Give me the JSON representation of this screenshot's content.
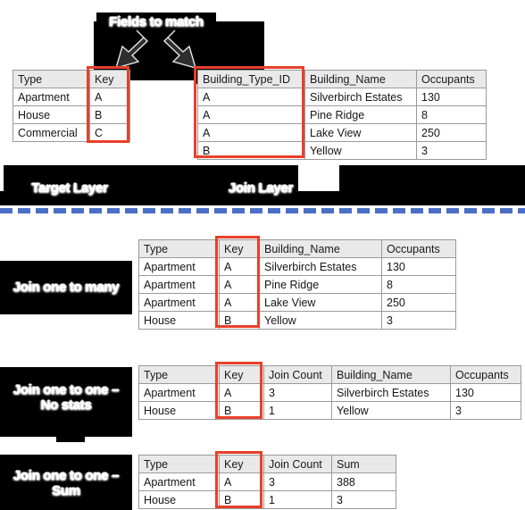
{
  "diagram": {
    "title_callout": "Fields to match",
    "layer_labels": {
      "target": "Target Layer",
      "join": "Join Layer"
    },
    "section_labels": {
      "one_to_many": "Join one to many",
      "one_to_one_no_stats": "Join one to one –\nNo stats",
      "one_to_one_sum": "Join one to one –\nSum"
    },
    "colors": {
      "highlight": "#e8402a",
      "divider": "#4a6fc4",
      "callout_bg": "#000000",
      "table_header_bg": "#e9e9e9"
    },
    "icons": {
      "arrow_left": "arrow-down-left-icon",
      "arrow_right": "arrow-down-right-icon"
    }
  },
  "tables": {
    "target_layer": {
      "name": "Target Layer Table",
      "headers": [
        "Type",
        "Key"
      ],
      "rows": [
        [
          "Apartment",
          "A"
        ],
        [
          "House",
          "B"
        ],
        [
          "Commercial",
          "C"
        ]
      ]
    },
    "join_layer": {
      "name": "Join Layer Table",
      "headers": [
        "Building_Type_ID",
        "Building_Name",
        "Occupants"
      ],
      "rows": [
        [
          "A",
          "Silverbirch Estates",
          "130"
        ],
        [
          "A",
          "Pine Ridge",
          "8"
        ],
        [
          "A",
          "Lake View",
          "250"
        ],
        [
          "B",
          "Yellow",
          "3"
        ]
      ]
    },
    "one_to_many": {
      "name": "Join one to many result",
      "headers": [
        "Type",
        "Key",
        "Building_Name",
        "Occupants"
      ],
      "rows": [
        [
          "Apartment",
          "A",
          "Silverbirch Estates",
          "130"
        ],
        [
          "Apartment",
          "A",
          "Pine Ridge",
          "8"
        ],
        [
          "Apartment",
          "A",
          "Lake View",
          "250"
        ],
        [
          "House",
          "B",
          "Yellow",
          "3"
        ]
      ]
    },
    "one_to_one_no_stats": {
      "name": "Join one to one - no stats result",
      "headers": [
        "Type",
        "Key",
        "Join Count",
        "Building_Name",
        "Occupants"
      ],
      "rows": [
        [
          "Apartment",
          "A",
          "3",
          "Silverbirch Estates",
          "130"
        ],
        [
          "House",
          "B",
          "1",
          "Yellow",
          "3"
        ]
      ]
    },
    "one_to_one_sum": {
      "name": "Join one to one - sum result",
      "headers": [
        "Type",
        "Key",
        "Join Count",
        "Sum"
      ],
      "rows": [
        [
          "Apartment",
          "A",
          "3",
          "388"
        ],
        [
          "House",
          "B",
          "1",
          "3"
        ]
      ]
    }
  }
}
